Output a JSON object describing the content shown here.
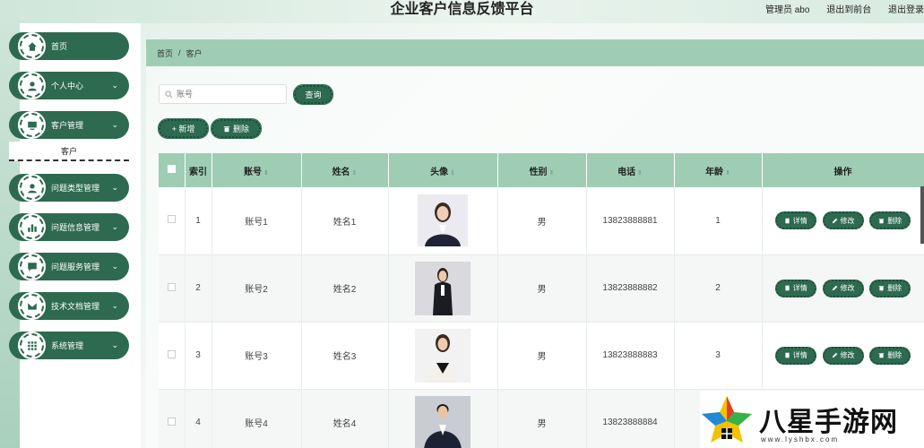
{
  "header": {
    "title": "企业客户信息反馈平台",
    "admin": "管理员 abo",
    "exit_console": "退出到前台",
    "logout": "退出登录"
  },
  "sidebar": {
    "items": [
      {
        "label": "首页",
        "icon": "home-icon",
        "has_chevron": false
      },
      {
        "label": "个人中心",
        "icon": "user-icon",
        "has_chevron": true
      },
      {
        "label": "客户管理",
        "icon": "monitor-icon",
        "has_chevron": true
      },
      {
        "label": "问题类型管理",
        "icon": "user-icon",
        "has_chevron": true
      },
      {
        "label": "问题信息管理",
        "icon": "chart-icon",
        "has_chevron": true
      },
      {
        "label": "问题服务管理",
        "icon": "chat-icon",
        "has_chevron": true
      },
      {
        "label": "技术文档管理",
        "icon": "email-icon",
        "has_chevron": true
      },
      {
        "label": "系统管理",
        "icon": "grid-icon",
        "has_chevron": true
      }
    ],
    "sub_item": "客户"
  },
  "breadcrumb": {
    "home": "首页",
    "sep": "/",
    "current": "客户"
  },
  "search": {
    "placeholder": "账号",
    "button": "查询"
  },
  "toolbar": {
    "add": "新增",
    "delete": "删除"
  },
  "table": {
    "columns": [
      "索引",
      "账号",
      "姓名",
      "头像",
      "性别",
      "电话",
      "年龄",
      "操作"
    ],
    "actions": {
      "detail": "详情",
      "edit": "修改",
      "delete": "删除"
    },
    "rows": [
      {
        "index": "1",
        "account": "账号1",
        "name": "姓名1",
        "gender": "男",
        "phone": "13823888881",
        "age": "1"
      },
      {
        "index": "2",
        "account": "账号2",
        "name": "姓名2",
        "gender": "男",
        "phone": "13823888882",
        "age": "2"
      },
      {
        "index": "3",
        "account": "账号3",
        "name": "姓名3",
        "gender": "男",
        "phone": "13823888883",
        "age": "3"
      },
      {
        "index": "4",
        "account": "账号4",
        "name": "姓名4",
        "gender": "男",
        "phone": "13823888884",
        "age": ""
      }
    ]
  },
  "watermark": {
    "text": "八星手游网",
    "url": "www.lyshbx.com"
  },
  "colors": {
    "accent": "#2d6a4f",
    "header_bg": "#9fcdb4"
  }
}
